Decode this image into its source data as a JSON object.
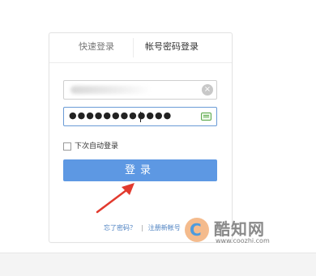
{
  "tabs": {
    "quick_login": "快速登录",
    "account_login": "帐号密码登录"
  },
  "username_field": {
    "value_obscured": true
  },
  "password_field": {
    "value": "●●●●●●●●●●●●"
  },
  "remember": {
    "label": "下次自动登录",
    "checked": false
  },
  "login_button": {
    "label": "登录"
  },
  "footer": {
    "forgot_password": "忘了密码？",
    "separator": "|",
    "register": "注册新帐号"
  },
  "watermark": {
    "name": "酷知网",
    "url": "www.coozhi.com"
  },
  "colors": {
    "button": "#5d98e3",
    "link": "#4a7fc0",
    "arrow": "#e23a2e"
  },
  "icons": {
    "clear": "clear-icon",
    "keyboard": "keyboard-icon"
  }
}
